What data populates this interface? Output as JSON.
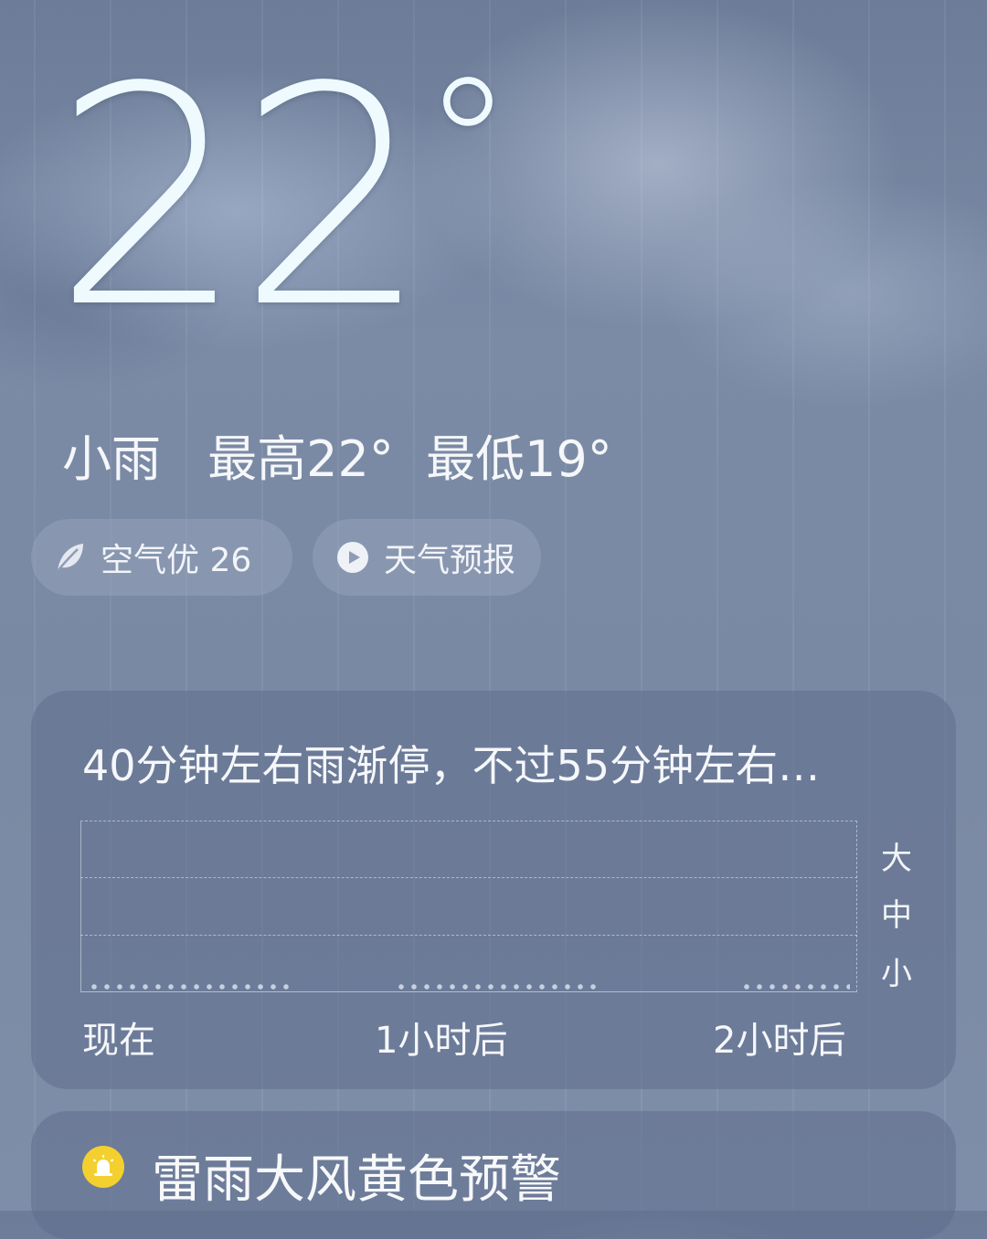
{
  "current": {
    "temperature": "22",
    "degree_symbol": "°",
    "condition": "小雨",
    "high": "最高22°",
    "low": "最低19°"
  },
  "chips": {
    "air_quality": "空气优 26",
    "forecast_video": "天气预报"
  },
  "precipitation": {
    "summary": "40分钟左右雨渐停，不过55分钟左右…",
    "intensity_scale": [
      "大",
      "中",
      "小"
    ],
    "time_labels": [
      "现在",
      "1小时后",
      "2小时后"
    ]
  },
  "alert": {
    "title": "雷雨大风黄色预警",
    "level_color": "#f3d02f"
  },
  "icons": {
    "air": "leaf-icon",
    "video": "play-icon",
    "alert": "alarm-icon"
  }
}
